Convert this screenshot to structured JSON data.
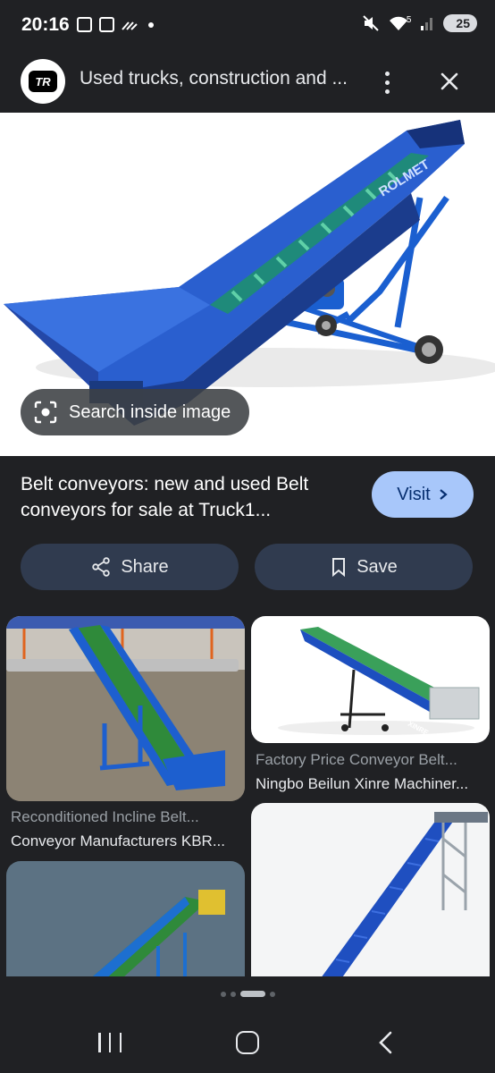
{
  "status_bar": {
    "time": "20:16",
    "network": "5",
    "battery": "25"
  },
  "header": {
    "logo_text": "TR",
    "title": "Used trucks, construction and ...",
    "icons": {
      "more": "more-vert-icon",
      "close": "close-icon"
    }
  },
  "main_image": {
    "brand_text": "ROLMET",
    "lens_label": "Search inside image"
  },
  "result": {
    "title_line1": "Belt conveyors: new and used Belt",
    "title_line2": "conveyors for sale at Truck1...",
    "visit_label": "Visit"
  },
  "actions": {
    "share_label": "Share",
    "save_label": "Save"
  },
  "related": [
    {
      "title": "Reconditioned Incline Belt...",
      "source": "Conveyor Manufacturers KBR..."
    },
    {
      "title": "Factory Price Conveyor Belt...",
      "source": "Ningbo Beilun Xinre Machiner...",
      "brand_text": "XINRE"
    }
  ],
  "colors": {
    "background": "#202124",
    "visit_button": "#a8c7fa",
    "action_button": "#303b4f",
    "conveyor_blue": "#1a5fd0"
  }
}
